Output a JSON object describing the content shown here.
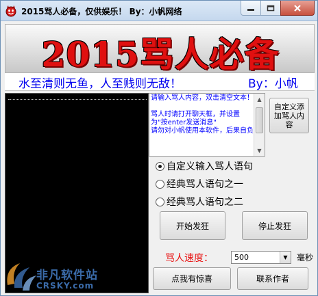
{
  "window": {
    "title": "2015骂人必备，仅供娱乐！ By：小帆网络",
    "icon": "devil-face-icon"
  },
  "banner": {
    "title": "2015骂人必备",
    "slogan": "水至清则无鱼，人至贱则无敌！",
    "author": "By：小帆",
    "title_color": "#e01010",
    "slogan_color": "#0000ee"
  },
  "hint_box": {
    "text": "请输入骂人内容，双击清空文本！\n\n骂人时请打开聊天框，并设置为\"按enter发送消息\"\n请勿对小帆使用本软件，后果自负"
  },
  "buttons": {
    "custom_add": "自定义添加骂人内容",
    "start": "开始发狂",
    "stop": "停止发狂",
    "surprise": "点我有惊喜",
    "contact": "联系作者"
  },
  "modes": [
    {
      "label": "自定义输入骂人语句",
      "selected": true
    },
    {
      "label": "经典骂人语句之一",
      "selected": false
    },
    {
      "label": "经典骂人语句之二",
      "selected": false
    }
  ],
  "speed": {
    "label": "骂人速度：",
    "value": "500",
    "unit": "毫秒"
  },
  "watermark": {
    "name": "非凡软件站",
    "site": "CRSKY.com"
  }
}
